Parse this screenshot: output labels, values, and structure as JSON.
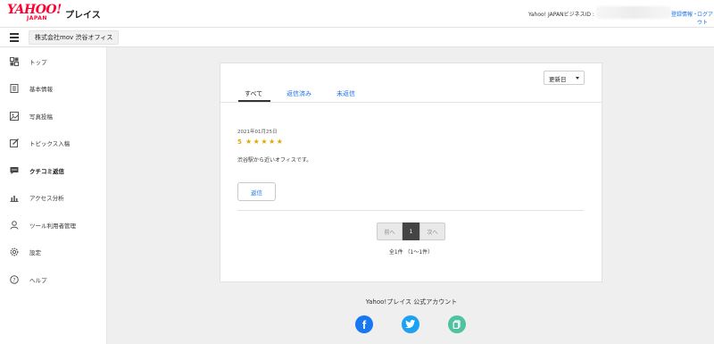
{
  "header": {
    "logo_text": "YAHOO!",
    "logo_sub": "JAPAN",
    "brand": "プレイス",
    "business_id_label": "Yahoo! JAPANビジネスID :",
    "links": {
      "register": "登録情報",
      "separator": "・",
      "logout": "ログアウト"
    },
    "colors": {
      "logo": "#ff0033",
      "link": "#1a73e8"
    }
  },
  "subheader": {
    "menu_icon": "hamburger-icon",
    "account_name": "株式会社mov 渋谷オフィス"
  },
  "sidebar": {
    "items": [
      {
        "label": "トップ",
        "icon": "dashboard-icon"
      },
      {
        "label": "基本情報",
        "icon": "document-icon"
      },
      {
        "label": "写真投稿",
        "icon": "photo-icon"
      },
      {
        "label": "トピックス入稿",
        "icon": "pencil-icon"
      },
      {
        "label": "クチコミ返信",
        "icon": "chat-icon",
        "active": true
      },
      {
        "label": "アクセス分析",
        "icon": "bar-chart-icon"
      },
      {
        "label": "ツール利用者管理",
        "icon": "user-icon"
      },
      {
        "label": "設定",
        "icon": "gear-icon"
      },
      {
        "label": "ヘルプ",
        "icon": "help-icon"
      }
    ]
  },
  "main": {
    "sort": {
      "selected": "更新日"
    },
    "tabs": [
      {
        "label": "すべて",
        "active": true
      },
      {
        "label": "返信済み"
      },
      {
        "label": "未返信"
      }
    ],
    "review": {
      "date": "2021年01月25日",
      "score": "5",
      "stars": "★★★★★",
      "text": "渋谷駅から近いオフィスです。",
      "reply_label": "返信",
      "star_color": "#e0a800"
    },
    "pagination": {
      "prev": "前へ",
      "current": "1",
      "next": "次へ",
      "count_text": "全1件 （1〜1件）"
    }
  },
  "footer": {
    "title": "Yahoo!プレイス 公式アカウント",
    "social": [
      {
        "name": "facebook-icon",
        "glyph": "f",
        "color": "#1877f2"
      },
      {
        "name": "twitter-icon",
        "color": "#1da1f2"
      },
      {
        "name": "other-icon",
        "color": "#4fc3a1"
      }
    ]
  }
}
